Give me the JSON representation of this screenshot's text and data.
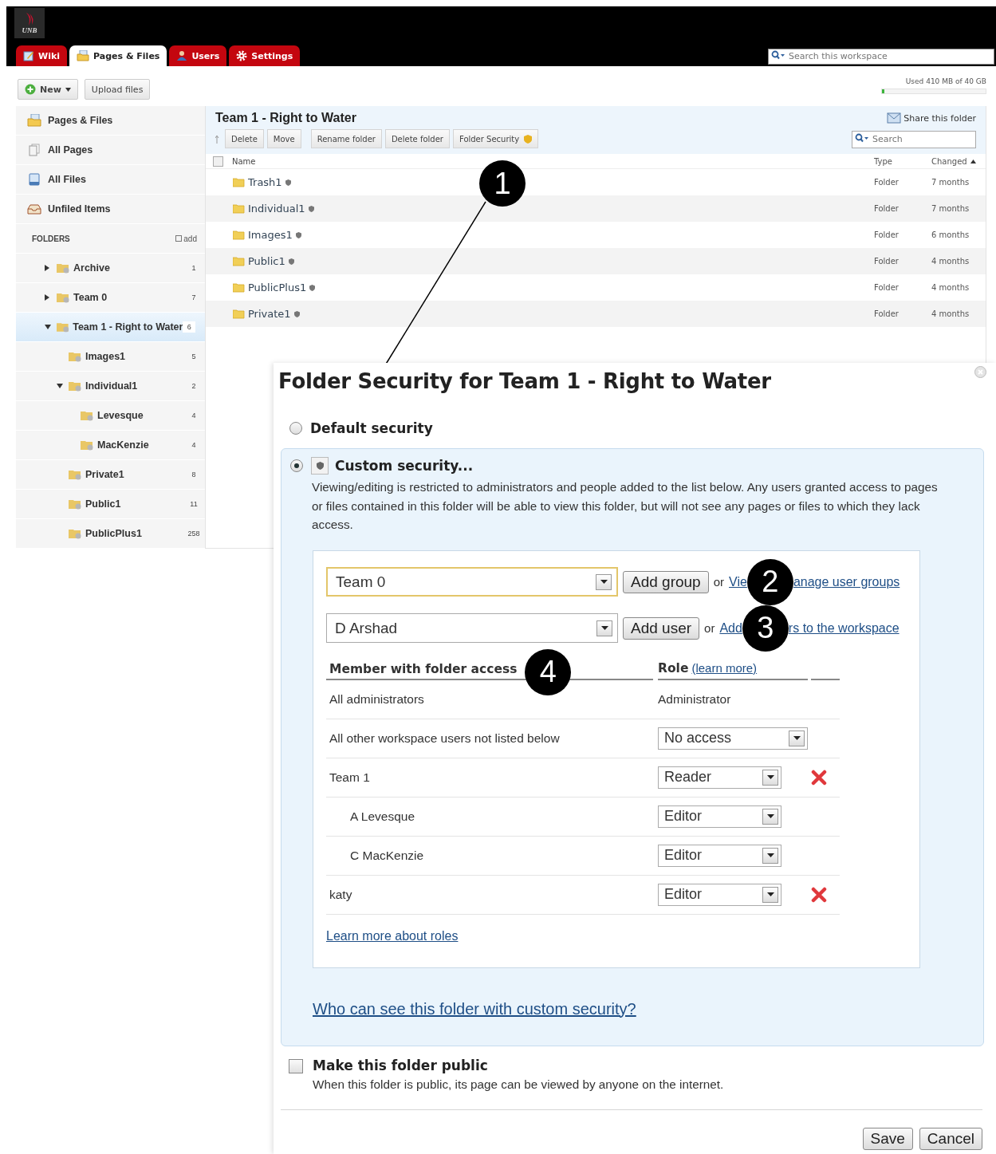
{
  "logo": {
    "text": "UNB"
  },
  "tabs": [
    {
      "label": "Wiki",
      "selected": false
    },
    {
      "label": "Pages & Files",
      "selected": true
    },
    {
      "label": "Users",
      "selected": false
    },
    {
      "label": "Settings",
      "selected": false
    }
  ],
  "workspace_search": {
    "placeholder": "Search this workspace"
  },
  "toolbar": {
    "new_button": "New",
    "upload_button": "Upload files",
    "storage": {
      "text": "Used 410 MB of 40 GB",
      "level": 0.02
    }
  },
  "sidebar": {
    "items": [
      {
        "label": "Pages & Files"
      },
      {
        "label": "All Pages"
      },
      {
        "label": "All Files"
      },
      {
        "label": "Unfiled Items"
      }
    ],
    "folders_heading": "FOLDERS",
    "add_link": "add",
    "tree": [
      {
        "label": "Archive",
        "count": "1",
        "expanded": false,
        "selected": false
      },
      {
        "label": "Team 0",
        "count": "7",
        "expanded": false,
        "selected": false
      },
      {
        "label": "Team 1 - Right to Water",
        "count": "6",
        "expanded": true,
        "selected": true,
        "children": [
          {
            "label": "Images1",
            "count": "5",
            "selected": false
          },
          {
            "label": "Individual1",
            "count": "2",
            "expanded": true,
            "selected": false,
            "children": [
              {
                "label": "Levesque",
                "count": "4",
                "selected": false
              },
              {
                "label": "MacKenzie",
                "count": "4",
                "selected": false
              }
            ]
          },
          {
            "label": "Private1",
            "count": "8",
            "selected": false
          },
          {
            "label": "Public1",
            "count": "11",
            "selected": false
          },
          {
            "label": "PublicPlus1",
            "count": "258",
            "selected": false
          }
        ]
      }
    ]
  },
  "folder": {
    "title": "Team 1 - Right to Water",
    "share_link": "Share this folder",
    "actions": [
      "Delete",
      "Move",
      "Rename folder",
      "Delete folder",
      "Folder Security"
    ],
    "search": {
      "placeholder": "Search"
    },
    "select_all_checked": false,
    "columns": [
      "Name",
      "Type",
      "Changed"
    ],
    "rows": [
      {
        "name": "Trash1",
        "type": "Folder",
        "changed": "7 months"
      },
      {
        "name": "Individual1",
        "type": "Folder",
        "changed": "7 months"
      },
      {
        "name": "Images1",
        "type": "Folder",
        "changed": "6 months"
      },
      {
        "name": "Public1",
        "type": "Folder",
        "changed": "4 months"
      },
      {
        "name": "PublicPlus1",
        "type": "Folder",
        "changed": "4 months"
      },
      {
        "name": "Private1",
        "type": "Folder",
        "changed": "4 months"
      }
    ]
  },
  "callout": "1",
  "dialog": {
    "title": "Folder Security for Team 1 - Right to Water",
    "options": [
      {
        "label": "Default security",
        "selected": false
      },
      {
        "label": "Custom security...",
        "selected": true,
        "description": "Viewing/editing is restricted to administrators and people added to the list below. Any users granted access to pages or files contained in this folder will be able to view this folder, but will not see any pages or files to which they lack access."
      }
    ],
    "group_row": {
      "value": "Team 0",
      "button": "Add group",
      "or": "or",
      "link_start": "Vie",
      "callout": "2",
      "link_end": "anage user groups"
    },
    "user_row": {
      "value": "D Arshad",
      "button": "Add user",
      "or": "or",
      "link_start": "Add",
      "callout": "3",
      "link_end": "rs to the workspace"
    },
    "access_table": {
      "member_heading": "Member with folder access",
      "callout": "4",
      "role_heading": "Role",
      "role_link": "(learn more)",
      "rows": [
        {
          "member": "All administrators",
          "role": "Administrator",
          "kind": "text",
          "indented": false,
          "removable": false
        },
        {
          "member": "All other workspace users not listed below",
          "role": "No access",
          "kind": "wide-select",
          "indented": false,
          "removable": false
        },
        {
          "member": "Team 1",
          "role": "Reader",
          "kind": "select",
          "indented": false,
          "removable": true
        },
        {
          "member": "A Levesque",
          "role": "Editor",
          "kind": "select",
          "indented": true,
          "removable": false
        },
        {
          "member": "C MacKenzie",
          "role": "Editor",
          "kind": "select",
          "indented": true,
          "removable": false
        },
        {
          "member": "katy",
          "role": "Editor",
          "kind": "select",
          "indented": false,
          "removable": true
        }
      ]
    },
    "roles_link": "Learn more about roles",
    "who_link": "Who can see this folder with custom security?",
    "public": {
      "label": "Make this folder public",
      "checked": false,
      "description": "When this folder is public, its page can be viewed by anyone on the internet."
    },
    "buttons": [
      "Save",
      "Cancel"
    ]
  }
}
